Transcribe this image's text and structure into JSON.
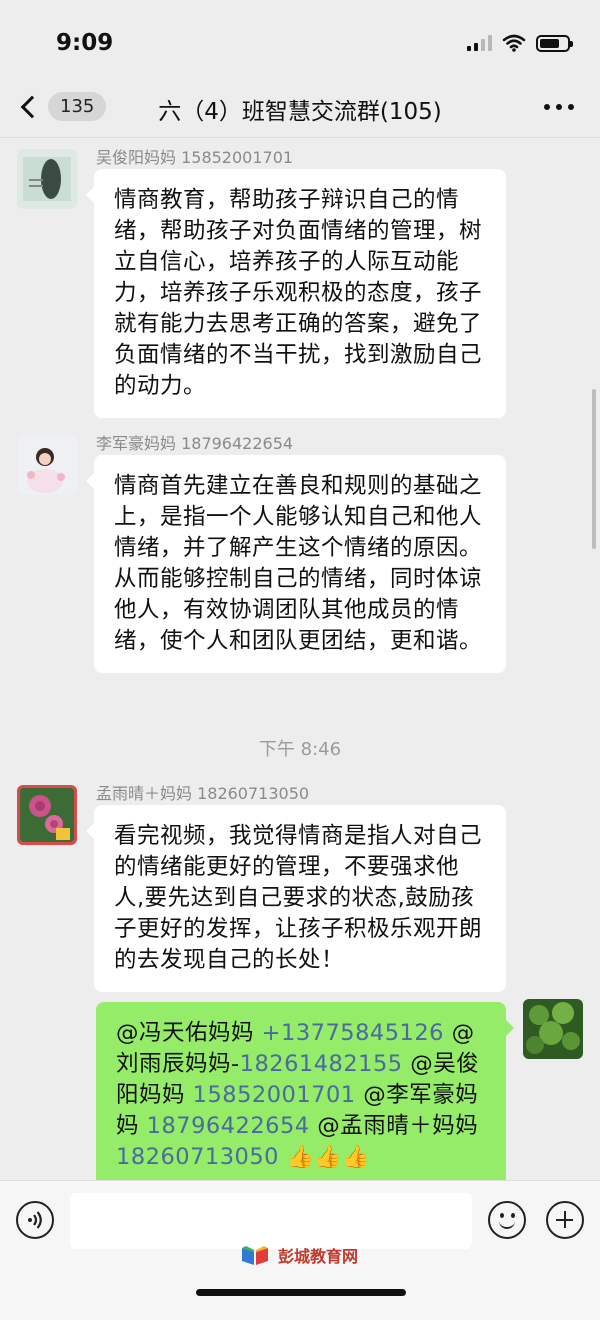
{
  "status_bar": {
    "time": "9:09"
  },
  "header": {
    "unread_count": "135",
    "title": "六（4）班智慧交流群(105)"
  },
  "messages": [
    {
      "sender": "吴俊阳妈妈 15852001701",
      "text": "情商教育，帮助孩子辩识自己的情绪，帮助孩子对负面情绪的管理，树立自信心，培养孩子的人际互动能力，培养孩子乐观积极的态度，孩子就有能力去思考正确的答案，避免了负面情绪的不当干扰，找到激励自己的动力。"
    },
    {
      "sender": "李军豪妈妈 18796422654",
      "text": "情商首先建立在善良和规则的基础之上，是指一个人能够认知自己和他人情绪，并了解产生这个情绪的原因。从而能够控制自己的情绪，同时体谅他人，有效协调团队其他成员的情绪，使个人和团队更团结，更和谐。"
    },
    {
      "sender": "孟雨晴＋妈妈 18260713050",
      "text": "看完视频，我觉得情商是指人对自己的情绪能更好的管理，不要强求他人,要先达到自己要求的状态,鼓励孩子更好的发挥，让孩子积极乐观开朗的去发现自己的长处！"
    }
  ],
  "time_divider": "下午 8:46",
  "own_message": {
    "parts": [
      "@冯天佑妈妈 ",
      "+13775845126",
      " @刘雨辰妈妈-",
      "18261482155",
      " @吴俊阳妈妈 ",
      "15852001701",
      " @李军豪妈妈 ",
      "18796422654",
      " @孟雨晴＋妈妈 ",
      "18260713050",
      " 👍👍👍"
    ]
  },
  "watermark": {
    "text": "彭城教育网"
  },
  "colors": {
    "background": "#ededed",
    "own_bubble": "#95ec69",
    "other_bubble": "#ffffff",
    "phone_number_link": "#4a6aa0"
  },
  "icons": {
    "back": "chevron-left-icon",
    "more": "more-dots-icon",
    "voice": "voice-icon",
    "emoji": "emoji-icon",
    "plus": "plus-icon"
  }
}
